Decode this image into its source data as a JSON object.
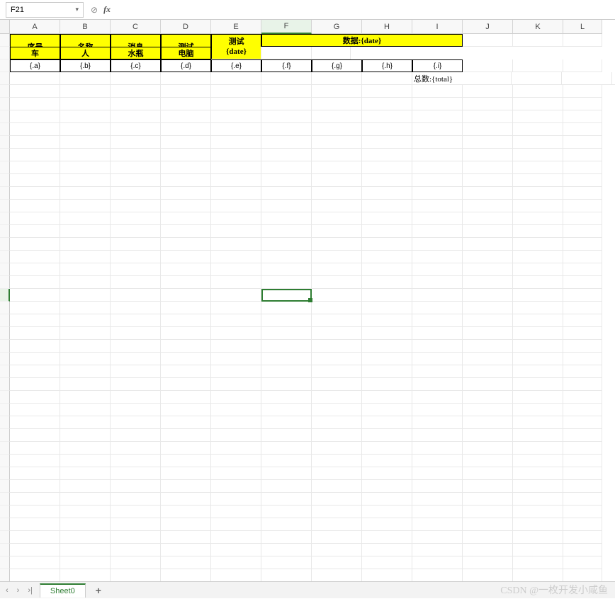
{
  "name_box": "F21",
  "fx_label": "fx",
  "columns": [
    "A",
    "B",
    "C",
    "D",
    "E",
    "F",
    "G",
    "H",
    "I",
    "J",
    "K",
    "L"
  ],
  "selected_col": "F",
  "selected_row_index": 20,
  "headers": {
    "a": "序号",
    "b": "名称",
    "c": "消息",
    "d": "测试",
    "e": "测试{date}",
    "data_span": "数据:{date}",
    "f": "车",
    "g": "人",
    "h": "水瓶",
    "i": "电脑"
  },
  "data_row": {
    "a": "{.a}",
    "b": "{.b}",
    "c": "{.c}",
    "d": "{.d}",
    "e": "{.e}",
    "f": "{.f}",
    "g": "{.g}",
    "h": "{.h}",
    "i": "{.i}"
  },
  "total_text": "总数:{total}",
  "sheet_name": "Sheet0",
  "add_label": "+",
  "watermark": "CSDN @一枚开发小咸鱼",
  "nav": {
    "first": "|‹",
    "prev": "‹",
    "next": "›",
    "last": "›|"
  }
}
